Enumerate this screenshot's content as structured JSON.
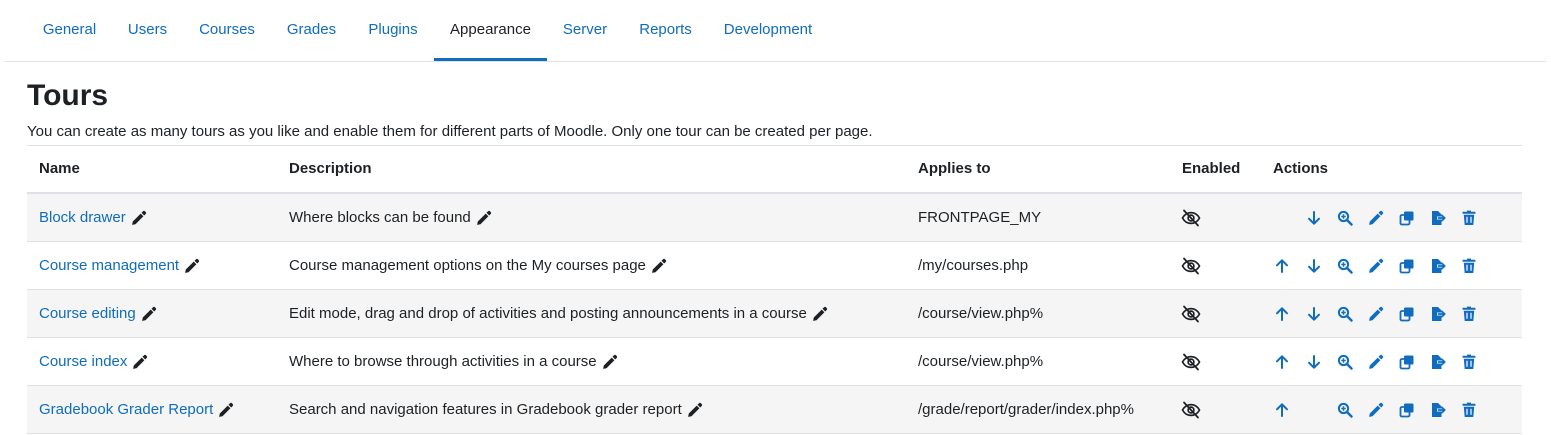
{
  "tabs": [
    {
      "label": "General"
    },
    {
      "label": "Users"
    },
    {
      "label": "Courses"
    },
    {
      "label": "Grades"
    },
    {
      "label": "Plugins"
    },
    {
      "label": "Appearance",
      "active": true
    },
    {
      "label": "Server"
    },
    {
      "label": "Reports"
    },
    {
      "label": "Development"
    }
  ],
  "page": {
    "title": "Tours",
    "intro": "You can create as many tours as you like and enable them for different parts of Moodle. Only one tour can be created per page."
  },
  "table": {
    "headers": {
      "name": "Name",
      "description": "Description",
      "applies_to": "Applies to",
      "enabled": "Enabled",
      "actions": "Actions"
    },
    "rows": [
      {
        "name": "Block drawer",
        "description": "Where blocks can be found",
        "applies_to": "FRONTPAGE_MY",
        "enabled_icon": "eye-slash-icon",
        "actions": [
          "move-down",
          "view",
          "edit",
          "duplicate",
          "export",
          "delete"
        ]
      },
      {
        "name": "Course management",
        "description": "Course management options on the My courses page",
        "applies_to": "/my/courses.php",
        "enabled_icon": "eye-slash-icon",
        "actions": [
          "move-up",
          "move-down",
          "view",
          "edit",
          "duplicate",
          "export",
          "delete"
        ]
      },
      {
        "name": "Course editing",
        "description": "Edit mode, drag and drop of activities and posting announcements in a course",
        "applies_to": "/course/view.php%",
        "enabled_icon": "eye-slash-icon",
        "actions": [
          "move-up",
          "move-down",
          "view",
          "edit",
          "duplicate",
          "export",
          "delete"
        ]
      },
      {
        "name": "Course index",
        "description": "Where to browse through activities in a course",
        "applies_to": "/course/view.php%",
        "enabled_icon": "eye-slash-icon",
        "actions": [
          "move-up",
          "move-down",
          "view",
          "edit",
          "duplicate",
          "export",
          "delete"
        ]
      },
      {
        "name": "Gradebook Grader Report",
        "description": "Search and navigation features in Gradebook grader report",
        "applies_to": "/grade/report/grader/index.php%",
        "enabled_icon": "eye-slash-icon",
        "actions": [
          "move-up",
          "view",
          "edit",
          "duplicate",
          "export",
          "delete"
        ]
      }
    ]
  },
  "colors": {
    "link": "#0f6cbf",
    "text": "#1d2125",
    "row_alt": "#f5f5f5",
    "border": "#dee2e6"
  }
}
